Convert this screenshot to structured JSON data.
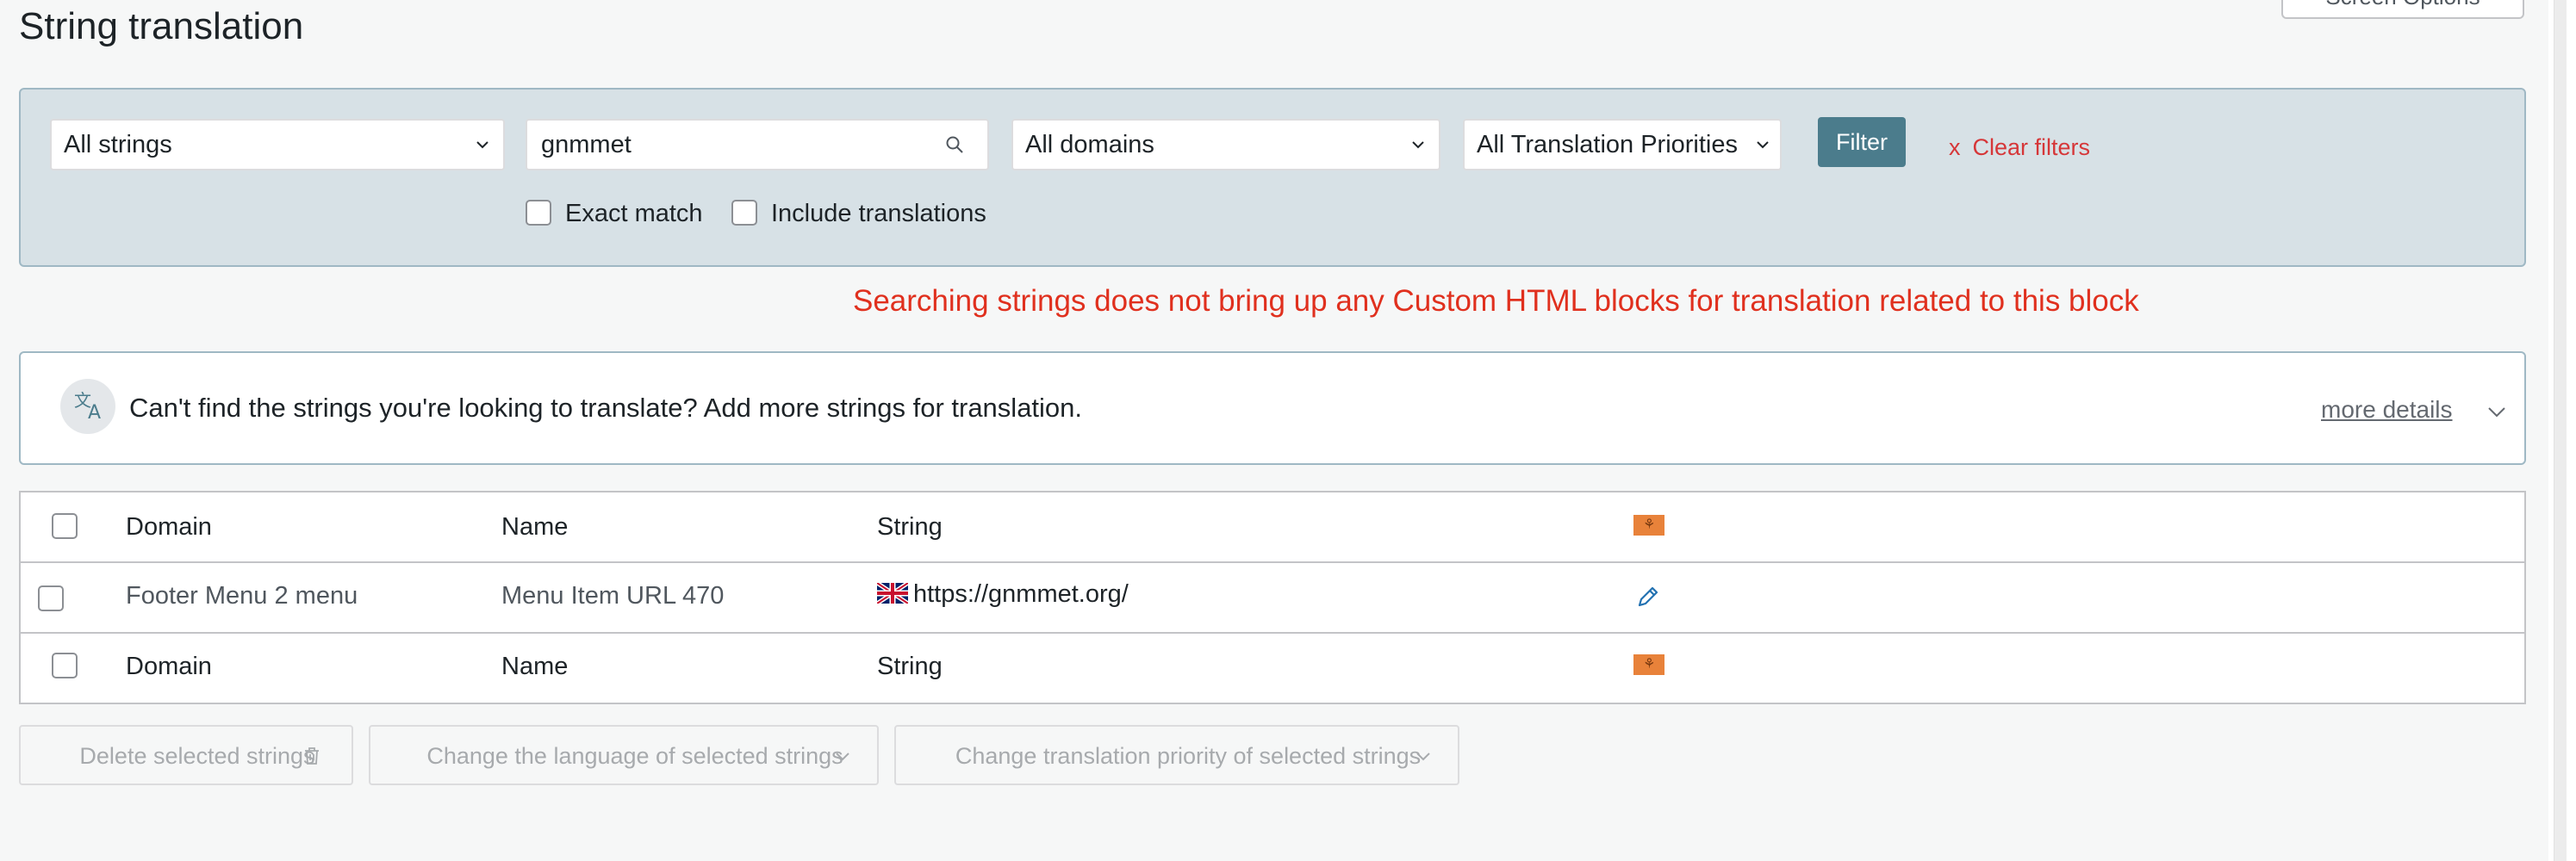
{
  "page": {
    "title": "String translation",
    "screen_options_label": "Screen Options"
  },
  "filters": {
    "string_status": "All strings",
    "search_value": "gnmmet",
    "domain": "All domains",
    "priority": "All Translation Priorities",
    "filter_button": "Filter",
    "clear_icon": "x",
    "clear_label": "Clear filters",
    "exact_match_label": "Exact match",
    "include_translations_label": "Include translations"
  },
  "annotation": "Searching strings does not bring up any Custom HTML blocks for translation related to this block",
  "notice": {
    "icon": "translate-icon",
    "text": "Can't find the strings you're looking to translate? Add more strings for translation.",
    "more_details": "more details"
  },
  "table": {
    "header": {
      "domain": "Domain",
      "name": "Name",
      "string": "String"
    },
    "rows": [
      {
        "domain": "Footer Menu 2 menu",
        "name": "Menu Item URL 470",
        "string": "https://gnmmet.org/"
      }
    ],
    "footer": {
      "domain": "Domain",
      "name": "Name",
      "string": "String"
    }
  },
  "bulk_actions": {
    "delete": "Delete selected strings",
    "change_language": "Change the language of selected strings",
    "change_priority": "Change translation priority of selected strings"
  },
  "colors": {
    "accent": "#4b7c8c",
    "danger": "#d63638",
    "annotation": "#e0301e",
    "panel_bg": "#d7e1e6",
    "flag": "#e8823a"
  }
}
